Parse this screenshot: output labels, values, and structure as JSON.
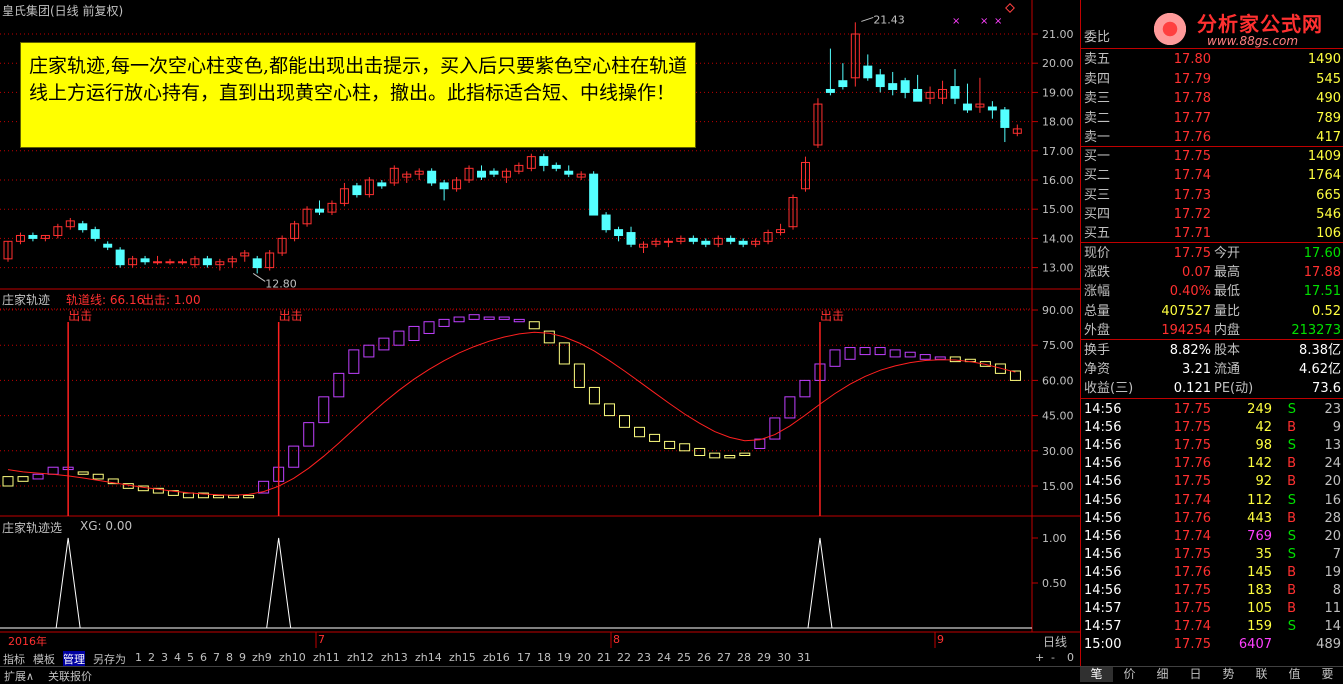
{
  "header": {
    "title": "皇氏集团(日线 前复权)",
    "logo": "分析家公式网",
    "logo_url": "www.88gs.com"
  },
  "note": "庄家轨迹,每一次空心柱变色,都能出现出击提示，买入后只要紫色空心柱在轨道线上方运行放心持有，直到出现黄空心柱，撤出。此指标适合短、中线操作！",
  "main_chart": {
    "high_label": "21.43",
    "low_label": "12.80",
    "y_ticks": [
      "21.00",
      "20.00",
      "19.00",
      "18.00",
      "17.00",
      "16.00",
      "15.00",
      "14.00",
      "13.00"
    ]
  },
  "indicator1": {
    "name": "庄家轨迹",
    "line_label": "轨道线: 66.16",
    "signal_label": "出击: 1.00",
    "signal_text": "出击",
    "y_ticks": [
      "90.00",
      "75.00",
      "60.00",
      "45.00",
      "30.00",
      "15.00"
    ]
  },
  "indicator2": {
    "name": "庄家轨迹选",
    "xg_label": "XG: 0.00",
    "y_ticks": [
      "1.00",
      "0.50"
    ]
  },
  "time_axis": {
    "labels": [
      "2016年",
      "7",
      "8",
      "9"
    ],
    "period": "日线"
  },
  "bottom_tabs": [
    "指标",
    "模板",
    "管理",
    "另存为",
    "1",
    "2",
    "3",
    "4",
    "5",
    "6",
    "7",
    "8",
    "9",
    "zh9",
    "zh10",
    "zh11",
    "zh12",
    "zh13",
    "zh14",
    "zh15",
    "zb16",
    "17",
    "18",
    "19",
    "20",
    "21",
    "22",
    "23",
    "24",
    "25",
    "26",
    "27",
    "28",
    "29",
    "30",
    "31"
  ],
  "bottom_controls": [
    "+",
    "-",
    "0"
  ],
  "status_left": [
    "扩展∧",
    "关联报价"
  ],
  "order_book": {
    "header": "委比",
    "sells": [
      {
        "label": "卖五",
        "price": "17.80",
        "vol": "1490"
      },
      {
        "label": "卖四",
        "price": "17.79",
        "vol": "545"
      },
      {
        "label": "卖三",
        "price": "17.78",
        "vol": "490"
      },
      {
        "label": "卖二",
        "price": "17.77",
        "vol": "789"
      },
      {
        "label": "卖一",
        "price": "17.76",
        "vol": "417"
      }
    ],
    "buys": [
      {
        "label": "买一",
        "price": "17.75",
        "vol": "1409"
      },
      {
        "label": "买二",
        "price": "17.74",
        "vol": "1764"
      },
      {
        "label": "买三",
        "price": "17.73",
        "vol": "665"
      },
      {
        "label": "买四",
        "price": "17.72",
        "vol": "546"
      },
      {
        "label": "买五",
        "price": "17.71",
        "vol": "106"
      }
    ]
  },
  "quote": [
    {
      "l1": "现价",
      "v1": "17.75",
      "l2": "今开",
      "v2": "17.60"
    },
    {
      "l1": "涨跌",
      "v1": "0.07",
      "l2": "最高",
      "v2": "17.88"
    },
    {
      "l1": "涨幅",
      "v1": "0.40%",
      "l2": "最低",
      "v2": "17.51"
    },
    {
      "l1": "总量",
      "v1": "407527",
      "l2": "量比",
      "v2": "0.52"
    },
    {
      "l1": "外盘",
      "v1": "194254",
      "l2": "内盘",
      "v2": "213273"
    }
  ],
  "stats": [
    {
      "l1": "换手",
      "v1": "8.82%",
      "l2": "股本",
      "v2": "8.38亿"
    },
    {
      "l1": "净资",
      "v1": "3.21",
      "l2": "流通",
      "v2": "4.62亿"
    },
    {
      "l1": "收益(三)",
      "v1": "0.121",
      "l2": "PE(动)",
      "v2": "73.6"
    }
  ],
  "ticks": [
    {
      "t": "14:56",
      "p": "17.75",
      "v": "249",
      "d": "S",
      "n": "23"
    },
    {
      "t": "14:56",
      "p": "17.75",
      "v": "42",
      "d": "B",
      "n": "9"
    },
    {
      "t": "14:56",
      "p": "17.75",
      "v": "98",
      "d": "S",
      "n": "13"
    },
    {
      "t": "14:56",
      "p": "17.76",
      "v": "142",
      "d": "B",
      "n": "24"
    },
    {
      "t": "14:56",
      "p": "17.75",
      "v": "92",
      "d": "B",
      "n": "20"
    },
    {
      "t": "14:56",
      "p": "17.74",
      "v": "112",
      "d": "S",
      "n": "16"
    },
    {
      "t": "14:56",
      "p": "17.76",
      "v": "443",
      "d": "B",
      "n": "28"
    },
    {
      "t": "14:56",
      "p": "17.74",
      "v": "769",
      "d": "S",
      "n": "20"
    },
    {
      "t": "14:56",
      "p": "17.75",
      "v": "35",
      "d": "S",
      "n": "7"
    },
    {
      "t": "14:56",
      "p": "17.76",
      "v": "145",
      "d": "B",
      "n": "19"
    },
    {
      "t": "14:56",
      "p": "17.75",
      "v": "183",
      "d": "B",
      "n": "8"
    },
    {
      "t": "14:57",
      "p": "17.75",
      "v": "105",
      "d": "B",
      "n": "11"
    },
    {
      "t": "14:57",
      "p": "17.74",
      "v": "159",
      "d": "S",
      "n": "14"
    },
    {
      "t": "15:00",
      "p": "17.75",
      "v": "6407",
      "d": "",
      "n": "489"
    }
  ],
  "panel_tabs": [
    "笔",
    "价",
    "细",
    "日",
    "势",
    "联",
    "值",
    "要"
  ],
  "candles": [
    [
      13.3,
      13.9,
      13.2,
      13.9
    ],
    [
      13.9,
      14.2,
      13.8,
      14.1
    ],
    [
      14.1,
      14.2,
      13.9,
      14.0
    ],
    [
      14.0,
      14.1,
      13.9,
      14.1
    ],
    [
      14.1,
      14.5,
      14.0,
      14.4
    ],
    [
      14.4,
      14.7,
      14.3,
      14.6
    ],
    [
      14.5,
      14.6,
      14.2,
      14.3
    ],
    [
      14.3,
      14.4,
      13.9,
      14.0
    ],
    [
      13.8,
      13.9,
      13.6,
      13.7
    ],
    [
      13.6,
      13.7,
      13.0,
      13.1
    ],
    [
      13.1,
      13.4,
      13.0,
      13.3
    ],
    [
      13.3,
      13.4,
      13.1,
      13.2
    ],
    [
      13.2,
      13.4,
      13.1,
      13.2
    ],
    [
      13.2,
      13.3,
      13.1,
      13.2
    ],
    [
      13.2,
      13.3,
      13.1,
      13.2
    ],
    [
      13.1,
      13.4,
      13.0,
      13.3
    ],
    [
      13.3,
      13.4,
      13.0,
      13.1
    ],
    [
      13.1,
      13.3,
      12.9,
      13.2
    ],
    [
      13.2,
      13.4,
      13.0,
      13.3
    ],
    [
      13.4,
      13.6,
      13.2,
      13.5
    ],
    [
      13.3,
      13.4,
      12.8,
      13.0
    ],
    [
      13.0,
      13.6,
      12.9,
      13.5
    ],
    [
      13.5,
      14.1,
      13.4,
      14.0
    ],
    [
      14.0,
      14.6,
      13.9,
      14.5
    ],
    [
      14.5,
      15.1,
      14.4,
      15.0
    ],
    [
      15.0,
      15.3,
      14.8,
      14.9
    ],
    [
      14.9,
      15.3,
      14.8,
      15.2
    ],
    [
      15.2,
      15.9,
      15.1,
      15.7
    ],
    [
      15.8,
      15.9,
      15.4,
      15.5
    ],
    [
      15.5,
      16.1,
      15.4,
      16.0
    ],
    [
      15.9,
      16.0,
      15.7,
      15.8
    ],
    [
      15.9,
      16.5,
      15.8,
      16.4
    ],
    [
      16.1,
      16.3,
      15.9,
      16.2
    ],
    [
      16.2,
      16.4,
      16.0,
      16.3
    ],
    [
      16.3,
      16.4,
      15.8,
      15.9
    ],
    [
      15.9,
      16.0,
      15.3,
      15.7
    ],
    [
      15.7,
      16.1,
      15.6,
      16.0
    ],
    [
      16.0,
      16.5,
      15.9,
      16.4
    ],
    [
      16.3,
      16.5,
      16.0,
      16.1
    ],
    [
      16.3,
      16.4,
      16.1,
      16.2
    ],
    [
      16.1,
      16.4,
      15.9,
      16.3
    ],
    [
      16.3,
      16.6,
      16.2,
      16.5
    ],
    [
      16.4,
      16.9,
      16.3,
      16.8
    ],
    [
      16.8,
      16.9,
      16.3,
      16.5
    ],
    [
      16.5,
      16.6,
      16.3,
      16.4
    ],
    [
      16.3,
      16.5,
      16.1,
      16.2
    ],
    [
      16.1,
      16.3,
      16.0,
      16.2
    ],
    [
      16.2,
      16.3,
      14.8,
      14.8
    ],
    [
      14.8,
      14.9,
      14.2,
      14.3
    ],
    [
      14.3,
      14.4,
      13.9,
      14.1
    ],
    [
      14.2,
      14.4,
      13.7,
      13.8
    ],
    [
      13.7,
      13.9,
      13.5,
      13.8
    ],
    [
      13.8,
      14.0,
      13.7,
      13.9
    ],
    [
      13.9,
      14.0,
      13.7,
      13.9
    ],
    [
      13.9,
      14.1,
      13.8,
      14.0
    ],
    [
      14.0,
      14.1,
      13.8,
      13.9
    ],
    [
      13.9,
      14.0,
      13.7,
      13.8
    ],
    [
      13.8,
      14.1,
      13.7,
      14.0
    ],
    [
      14.0,
      14.1,
      13.8,
      13.9
    ],
    [
      13.9,
      14.0,
      13.7,
      13.8
    ],
    [
      13.8,
      14.0,
      13.7,
      13.9
    ],
    [
      13.9,
      14.3,
      13.8,
      14.2
    ],
    [
      14.2,
      14.5,
      14.1,
      14.3
    ],
    [
      14.4,
      15.5,
      14.3,
      15.4
    ],
    [
      15.7,
      16.8,
      15.6,
      16.6
    ],
    [
      17.2,
      18.8,
      17.1,
      18.6
    ],
    [
      19.1,
      20.5,
      18.9,
      19.0
    ],
    [
      19.4,
      20.0,
      19.1,
      19.2
    ],
    [
      19.5,
      21.4,
      19.2,
      21.0
    ],
    [
      19.9,
      20.3,
      19.4,
      19.5
    ],
    [
      19.6,
      19.8,
      19.0,
      19.2
    ],
    [
      19.3,
      19.7,
      18.9,
      19.1
    ],
    [
      19.4,
      19.5,
      18.8,
      19.0
    ],
    [
      19.1,
      19.6,
      18.7,
      18.7
    ],
    [
      18.8,
      19.2,
      18.6,
      19.0
    ],
    [
      18.8,
      19.4,
      18.6,
      19.1
    ],
    [
      19.2,
      19.8,
      18.6,
      18.8
    ],
    [
      18.6,
      19.3,
      18.3,
      18.4
    ],
    [
      18.5,
      19.5,
      18.3,
      18.6
    ],
    [
      18.5,
      18.7,
      18.1,
      18.4
    ],
    [
      18.4,
      18.5,
      17.3,
      17.8
    ],
    [
      17.6,
      17.9,
      17.5,
      17.75
    ]
  ],
  "track_boxes": [
    [
      15,
      19
    ],
    [
      17,
      19
    ],
    [
      18,
      20
    ],
    [
      20,
      23
    ],
    [
      22,
      23
    ],
    [
      20,
      21
    ],
    [
      18,
      20
    ],
    [
      16,
      18
    ],
    [
      14,
      16
    ],
    [
      13,
      15
    ],
    [
      12,
      14
    ],
    [
      11,
      13
    ],
    [
      10,
      12
    ],
    [
      10,
      12
    ],
    [
      10,
      11
    ],
    [
      10,
      11
    ],
    [
      10,
      11
    ],
    [
      12,
      17
    ],
    [
      17,
      23
    ],
    [
      23,
      32
    ],
    [
      32,
      42
    ],
    [
      42,
      53
    ],
    [
      53,
      63
    ],
    [
      63,
      73
    ],
    [
      70,
      75
    ],
    [
      73,
      78
    ],
    [
      75,
      81
    ],
    [
      77,
      83
    ],
    [
      80,
      85
    ],
    [
      83,
      86
    ],
    [
      85,
      87
    ],
    [
      86,
      88
    ],
    [
      86,
      87
    ],
    [
      86,
      87
    ],
    [
      85,
      86
    ],
    [
      82,
      85
    ],
    [
      76,
      81
    ],
    [
      67,
      76
    ],
    [
      57,
      67
    ],
    [
      50,
      57
    ],
    [
      45,
      50
    ],
    [
      40,
      45
    ],
    [
      36,
      40
    ],
    [
      34,
      37
    ],
    [
      31,
      34
    ],
    [
      30,
      33
    ],
    [
      28,
      31
    ],
    [
      27,
      29
    ],
    [
      27,
      28
    ],
    [
      28,
      29
    ],
    [
      31,
      35
    ],
    [
      35,
      44
    ],
    [
      44,
      53
    ],
    [
      53,
      60
    ],
    [
      60,
      67
    ],
    [
      66,
      73
    ],
    [
      69,
      74
    ],
    [
      71,
      74
    ],
    [
      71,
      74
    ],
    [
      70,
      73
    ],
    [
      70,
      72
    ],
    [
      69,
      71
    ],
    [
      69,
      70
    ],
    [
      68,
      70
    ],
    [
      68,
      69
    ],
    [
      66,
      68
    ],
    [
      63,
      67
    ],
    [
      60,
      64
    ]
  ],
  "track_line": [
    22,
    21,
    20.5,
    20,
    19.3,
    18.4,
    17.4,
    16.4,
    15.4,
    14.4,
    13.6,
    12.8,
    12.1,
    11.6,
    11.3,
    11.1,
    11.4,
    12.6,
    14.9,
    18.3,
    22.6,
    27.7,
    33.3,
    39.1,
    45.0,
    50.6,
    55.8,
    60.5,
    64.7,
    68.4,
    71.7,
    74.4,
    76.7,
    78.5,
    79.8,
    80.5,
    80.1,
    78.5,
    75.9,
    72.5,
    68.4,
    64.0,
    59.4,
    54.7,
    50.1,
    45.7,
    41.7,
    38.2,
    35.7,
    34.3,
    34.7,
    36.9,
    40.6,
    45.1,
    49.9,
    54.4,
    58.4,
    61.7,
    64.3,
    66.2,
    67.6,
    68.5,
    68.8,
    68.7,
    68.0,
    66.8,
    65.2,
    63.5
  ],
  "signals": [
    4,
    18,
    54
  ]
}
